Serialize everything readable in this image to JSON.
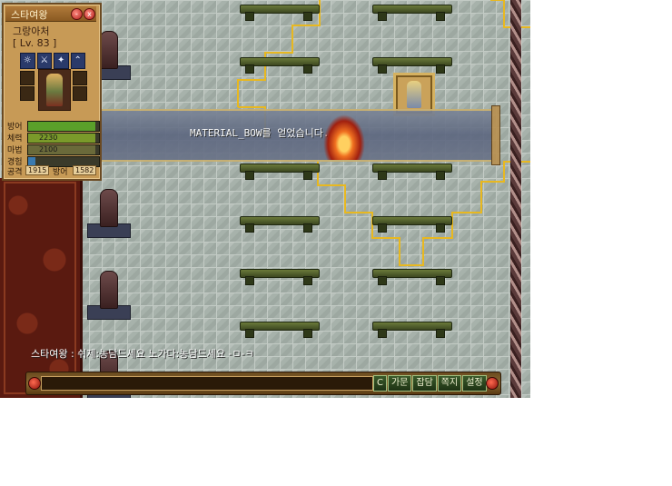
{
  "status_panel": {
    "title": "스타여왕",
    "minimize_glyph": "-",
    "close_glyph": "x",
    "character_name": "그랑아처",
    "level": "[ Lv. 83 ]",
    "skill_icons": [
      "sun-icon",
      "sword-icon",
      "star-icon",
      "wing-icon"
    ],
    "stats": [
      {
        "label": "방어",
        "value": "",
        "fill_fraction": 0.95,
        "color": "#5aa02a"
      },
      {
        "label": "체력",
        "value": "2230",
        "fill_fraction": 0.95,
        "color": "#7a9a2a"
      },
      {
        "label": "마법",
        "value": "2100",
        "fill_fraction": 0.95,
        "color": "#6a6a3a"
      },
      {
        "label": "경험",
        "value": "",
        "fill_fraction": 0.1,
        "color": "#3a7ab0"
      }
    ],
    "attack_label": "공격",
    "attack_value": "1915",
    "defense_label": "방어",
    "defense_value": "1582"
  },
  "message": "MATERIAL_BOW를 얻었습니다.",
  "chat_line": "스타여왕 : 쉬제:농담드세요 노가다:농담드세요 -ㅁ-ㅋ",
  "chat_input": {
    "value": "",
    "placeholder": ""
  },
  "menu_buttons": [
    "C",
    "가문",
    "잡담",
    "쪽지",
    "설정"
  ],
  "colors": {
    "path_line": "#e8b820",
    "panel": "#c79a56",
    "banner": "#6a7388"
  }
}
